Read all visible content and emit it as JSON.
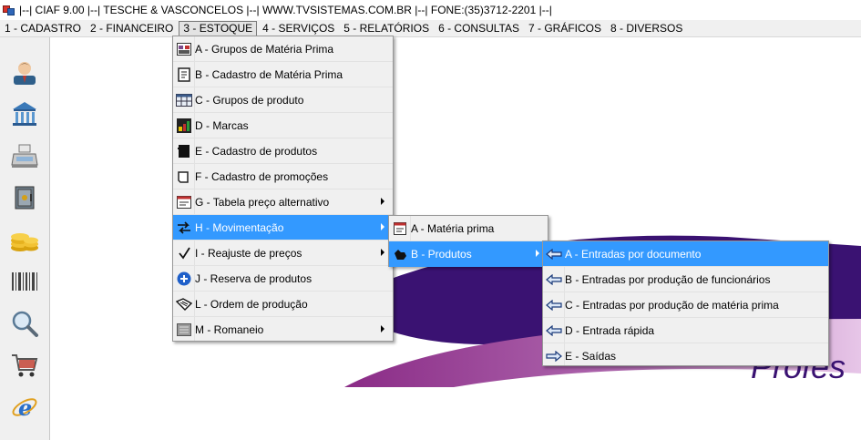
{
  "window": {
    "title": "|--| CIAF 9.00 |--| TESCHE & VASCONCELOS |--| WWW.TVSISTEMAS.COM.BR |--| FONE:(35)3712-2201 |--|"
  },
  "menubar": [
    "1 - CADASTRO",
    "2 - FINANCEIRO",
    "3 - ESTOQUE",
    "4 - SERVIÇOS",
    "5 - RELATÓRIOS",
    "6 - CONSULTAS",
    "7 - GRÁFICOS",
    "8 - DIVERSOS"
  ],
  "menubar_active_index": 2,
  "sidebar_icons": [
    "person-icon",
    "bank-icon",
    "cash-register-icon",
    "safe-icon",
    "coins-icon",
    "barcode-icon",
    "magnifier-icon",
    "cart-icon",
    "internet-explorer-icon"
  ],
  "estoque_menu": {
    "items": [
      {
        "label": "A - Grupos de Matéria Prima",
        "icon": "grid-group-icon",
        "submenu": false
      },
      {
        "label": "B - Cadastro de Matéria Prima",
        "icon": "box-icon",
        "submenu": false
      },
      {
        "label": "C - Grupos de produto",
        "icon": "table-icon",
        "submenu": false
      },
      {
        "label": "D - Marcas",
        "icon": "brand-tag-icon",
        "submenu": false
      },
      {
        "label": "E - Cadastro de produtos",
        "icon": "product-icon",
        "submenu": false
      },
      {
        "label": "F - Cadastro de promoções",
        "icon": "promo-icon",
        "submenu": false
      },
      {
        "label": "G - Tabela preço alternativo",
        "icon": "price-table-icon",
        "submenu": true
      },
      {
        "label": "H - Movimentação",
        "icon": "movement-icon",
        "submenu": true
      },
      {
        "label": "I - Reajuste de preços",
        "icon": "checkmark-icon",
        "submenu": true
      },
      {
        "label": "J - Reserva de produtos",
        "icon": "plus-circle-icon",
        "submenu": false
      },
      {
        "label": "L - Ordem de produção",
        "icon": "production-icon",
        "submenu": false
      },
      {
        "label": "M - Romaneio",
        "icon": "romaneio-icon",
        "submenu": true
      }
    ],
    "highlighted_index": 7
  },
  "movimentacao_menu": {
    "items": [
      {
        "label": "A - Matéria prima",
        "icon": "document-icon",
        "submenu": false
      },
      {
        "label": "B - Produtos",
        "icon": "hand-icon",
        "submenu": true
      }
    ],
    "highlighted_index": 1
  },
  "produtos_menu": {
    "items": [
      {
        "label": "A - Entradas por documento",
        "icon": "arrow-left-icon"
      },
      {
        "label": "B - Entradas por produção de funcionários",
        "icon": "arrow-left-icon"
      },
      {
        "label": "C - Entradas por produção de matéria prima",
        "icon": "arrow-left-icon"
      },
      {
        "label": "D - Entrada rápida",
        "icon": "arrow-left-icon"
      },
      {
        "label": "E - Saídas",
        "icon": "arrow-right-icon"
      }
    ],
    "highlighted_index": 0
  },
  "background_logo_text": "Profes",
  "colors": {
    "highlight": "#3399ff",
    "logo_purple": "#3a1272",
    "logo_magenta": "#8a2b86"
  }
}
